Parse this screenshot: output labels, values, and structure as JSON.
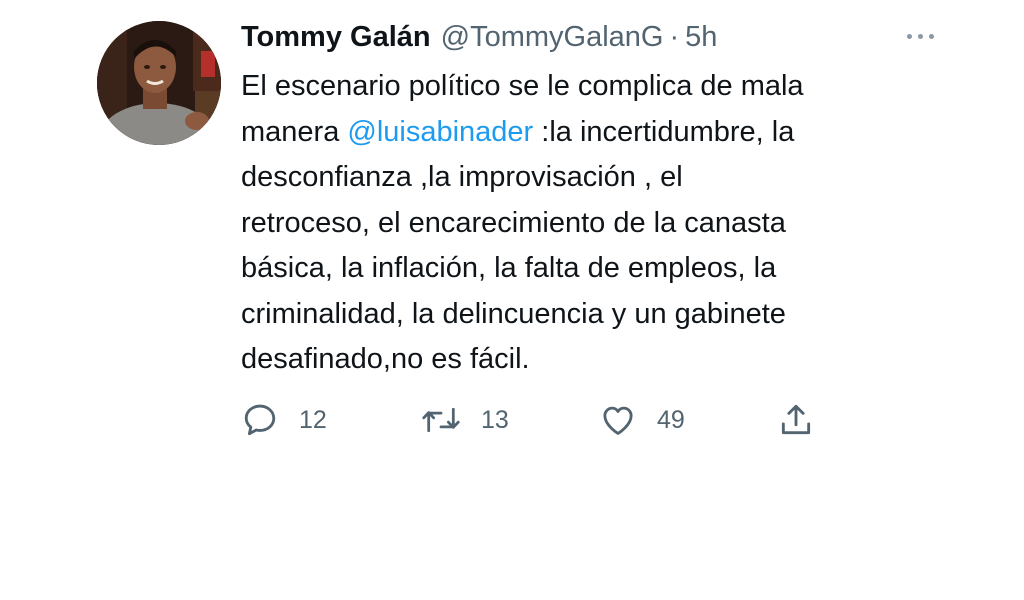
{
  "tweet": {
    "author": {
      "name": "Tommy Galán",
      "handle": "@TommyGalanG"
    },
    "separator": "·",
    "time": "5h",
    "more_icon": "more-horizontal-icon",
    "body": {
      "line1": "El escenario político se le complica de mala",
      "line2_prefix": "manera ",
      "mention": "@luisabinader",
      "line2_suffix": " :la incertidumbre, la",
      "line3": "desconfianza ,la improvisación , el",
      "line4": "retroceso, el encarecimiento de la canasta",
      "line5": "básica, la inflación, la falta de empleos, la",
      "line6": "criminalidad, la delincuencia y un gabinete",
      "line7": "desafinado,no es fácil."
    },
    "actions": {
      "reply": {
        "icon": "reply-icon",
        "count": "12"
      },
      "retweet": {
        "icon": "retweet-icon",
        "count": "13"
      },
      "like": {
        "icon": "heart-icon",
        "count": "49"
      },
      "share": {
        "icon": "share-icon"
      }
    },
    "colors": {
      "text": "#0f1419",
      "secondary": "#536471",
      "link": "#1d9bf0",
      "background": "#ffffff"
    }
  }
}
